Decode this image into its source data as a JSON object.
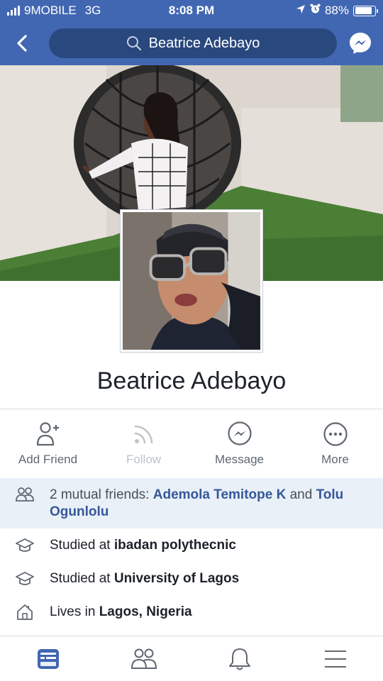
{
  "status_bar": {
    "carrier": "9MOBILE",
    "network": "3G",
    "time": "8:08 PM",
    "battery": "88%",
    "battery_level": 0.88,
    "icons": [
      "signal-icon",
      "location-arrow-icon",
      "alarm-icon",
      "battery-icon"
    ]
  },
  "nav": {
    "search_text": "Beatrice Adebayo",
    "icons": [
      "back-chevron-icon",
      "search-icon",
      "messenger-icon"
    ]
  },
  "profile": {
    "name": "Beatrice Adebayo"
  },
  "actions": [
    {
      "label": "Add Friend",
      "icon": "add-friend-icon",
      "enabled": true
    },
    {
      "label": "Follow",
      "icon": "follow-icon",
      "enabled": false
    },
    {
      "label": "Message",
      "icon": "messenger-icon",
      "enabled": true
    },
    {
      "label": "More",
      "icon": "more-icon",
      "enabled": true
    }
  ],
  "mutual": {
    "prefix": "2 mutual friends: ",
    "friend1": "Ademola Temitope K",
    "and": " and",
    "friend2": "Tolu Ogunlolu",
    "icon": "friends-icon"
  },
  "info": [
    {
      "prefix": "Studied at ",
      "value": "ibadan polythecnic",
      "icon": "graduation-cap-icon"
    },
    {
      "prefix": "Studied at ",
      "value": "University of Lagos",
      "icon": "graduation-cap-icon"
    },
    {
      "prefix": "Lives in ",
      "value": "Lagos, Nigeria",
      "icon": "home-icon"
    }
  ],
  "tabs": [
    {
      "icon": "news-feed-icon",
      "active": true
    },
    {
      "icon": "friends-icon",
      "active": false
    },
    {
      "icon": "notifications-bell-icon",
      "active": false
    },
    {
      "icon": "menu-icon",
      "active": false
    }
  ],
  "colors": {
    "brand": "#4267b2",
    "search_bg": "#29487d",
    "link": "#365899",
    "mutual_bg": "#e9f0f8",
    "icon_gray": "#606770"
  }
}
